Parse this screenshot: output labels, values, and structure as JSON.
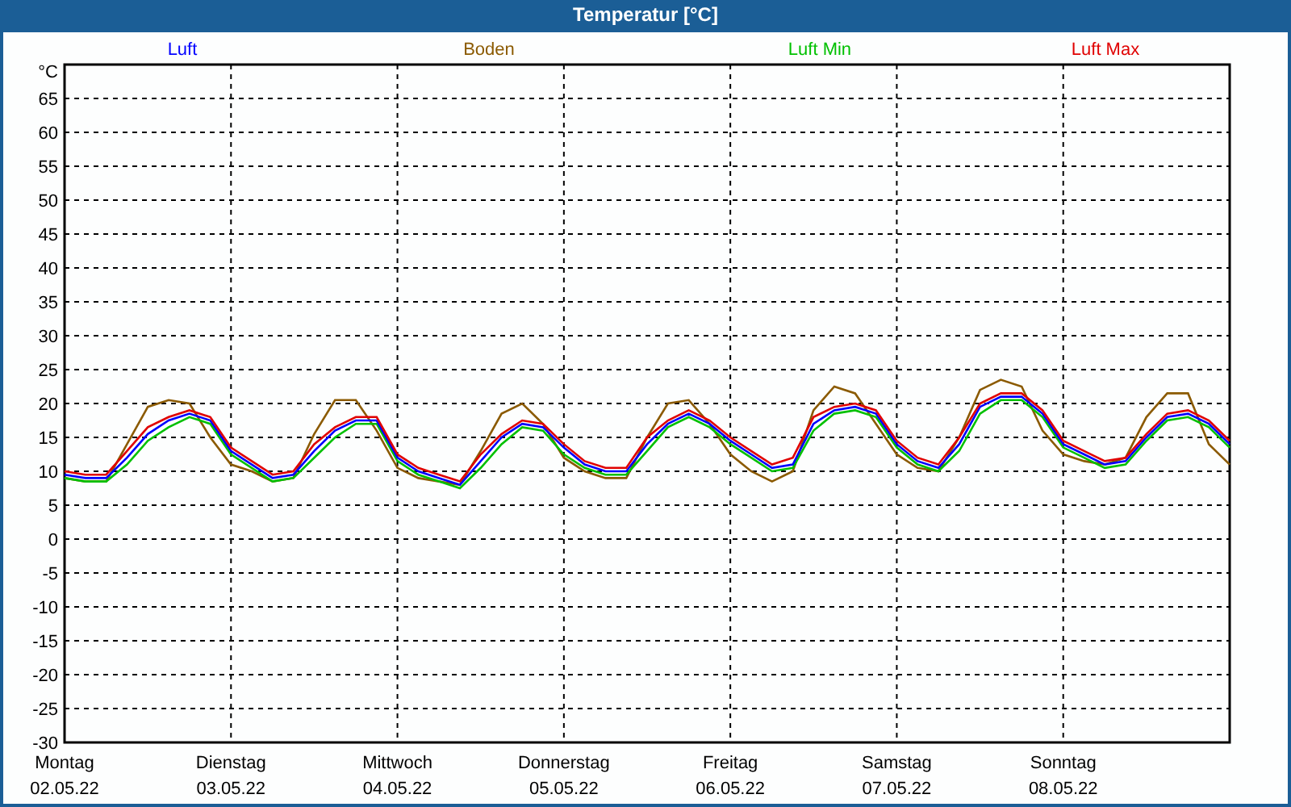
{
  "window": {
    "title": "Temperatur [°C]"
  },
  "panel": {
    "chart_data": {
      "type": "line",
      "ylabel": "°C",
      "categories": [
        "Montag",
        null,
        null,
        null,
        null,
        null,
        null,
        null,
        "Dienstag",
        null,
        null,
        null,
        null,
        null,
        null,
        null,
        "Mittwoch",
        null,
        null,
        null,
        null,
        null,
        null,
        null,
        "Donnerstag",
        null,
        null,
        null,
        null,
        null,
        null,
        null,
        "Freitag",
        null,
        null,
        null,
        null,
        null,
        null,
        null,
        "Samstag",
        null,
        null,
        null,
        null,
        null,
        null,
        null,
        "Sonntag",
        null,
        null,
        null,
        null,
        null,
        null,
        null,
        null
      ],
      "grid": true,
      "ylim": [
        -30,
        70
      ],
      "yticks": [
        65,
        60,
        55,
        50,
        45,
        40,
        35,
        30,
        25,
        20,
        15,
        10,
        5,
        0,
        -5,
        -10,
        -15,
        -20,
        -25,
        -30
      ],
      "series": [
        {
          "name": "Luft",
          "color": "#0000ff",
          "values": [
            9.5,
            9,
            9,
            12,
            15.5,
            17.5,
            18.5,
            17.5,
            13,
            11,
            9,
            9.5,
            13,
            16,
            17.5,
            17.5,
            12,
            10,
            9,
            8,
            11.5,
            15,
            17,
            16.5,
            13.5,
            11,
            10,
            10,
            14,
            17,
            18.5,
            17,
            14.5,
            12.5,
            10.5,
            11,
            17,
            19,
            19.5,
            18.5,
            14,
            11.5,
            10.5,
            14,
            19.5,
            21,
            21,
            18.5,
            14,
            12.5,
            11,
            11.5,
            15,
            18,
            18.5,
            17,
            14
          ]
        },
        {
          "name": "Boden",
          "color": "#8b5a00",
          "values": [
            9,
            8.5,
            8.5,
            14,
            19.5,
            20.5,
            20,
            15,
            11,
            10,
            8.5,
            9,
            15.5,
            20.5,
            20.5,
            16,
            10.5,
            9,
            8.5,
            8,
            13,
            18.5,
            20,
            17,
            12,
            10,
            9,
            9,
            15,
            20,
            20.5,
            17,
            12.5,
            10,
            8.5,
            10,
            19,
            22.5,
            21.5,
            17,
            12.5,
            10.5,
            10,
            15,
            22,
            23.5,
            22.5,
            16,
            12.5,
            11.5,
            11,
            12,
            18,
            21.5,
            21.5,
            14,
            11
          ]
        },
        {
          "name": "Luft Min",
          "color": "#00c000",
          "values": [
            9,
            8.5,
            8.5,
            11,
            14.5,
            16.5,
            18,
            17,
            12.5,
            10.5,
            8.5,
            9,
            12,
            15,
            17,
            17,
            11.5,
            9.5,
            8.5,
            7.5,
            10.5,
            14,
            16.5,
            16,
            12.5,
            10.5,
            9.5,
            9.5,
            13,
            16.5,
            18,
            16.5,
            14,
            12,
            10,
            10.5,
            16,
            18.5,
            19,
            18,
            13.5,
            11,
            10,
            13,
            18.5,
            20.5,
            20.5,
            18,
            13.5,
            12,
            10.5,
            11,
            14.5,
            17.5,
            18,
            16.5,
            13.5
          ]
        },
        {
          "name": "Luft Max",
          "color": "#e00000",
          "values": [
            10,
            9.5,
            9.5,
            13,
            16.5,
            18,
            19,
            18,
            13.5,
            11.5,
            9.5,
            10,
            14,
            16.5,
            18,
            18,
            12.5,
            10.5,
            9.5,
            8.5,
            12.5,
            15.5,
            17.5,
            17,
            14,
            11.5,
            10.5,
            10.5,
            15,
            17.5,
            19,
            17.5,
            15,
            13,
            11,
            12,
            18,
            19.5,
            20,
            19,
            14.5,
            12,
            11,
            15,
            20,
            21.5,
            21.5,
            19,
            14.5,
            13,
            11.5,
            12,
            15.5,
            18.5,
            19,
            17.5,
            14.5
          ]
        }
      ]
    },
    "dates": [
      "02.05.22",
      "03.05.22",
      "04.05.22",
      "05.05.22",
      "06.05.22",
      "07.05.22",
      "08.05.22"
    ]
  }
}
